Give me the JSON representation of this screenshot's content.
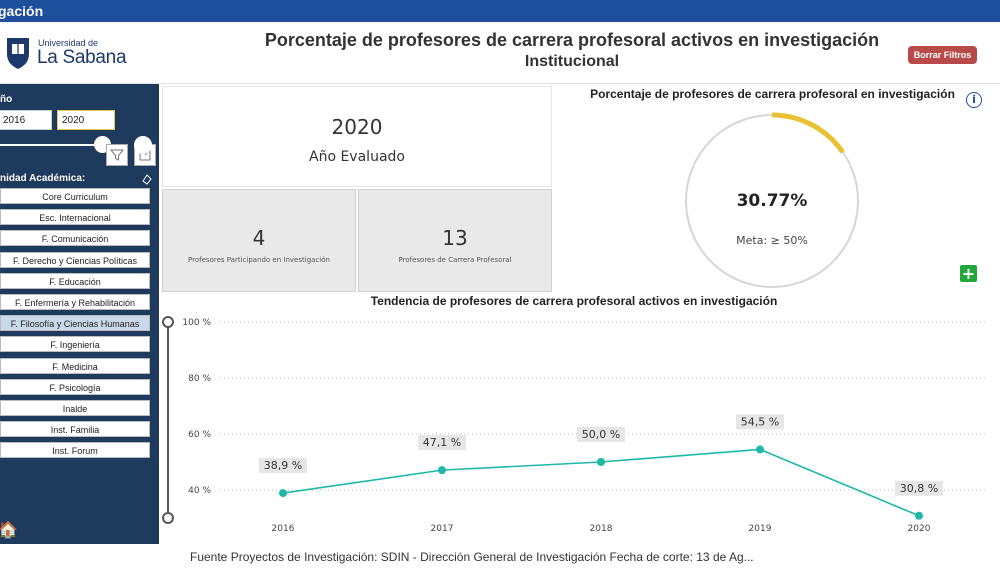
{
  "topbar": {
    "title": "gación"
  },
  "header": {
    "logo_line1": "Universidad de",
    "logo_line2": "La Sabana",
    "title_line1": "Porcentaje de profesores de carrera profesoral activos en investigación",
    "title_line2": "Institucional",
    "clear_filters": "Borrar Filtros"
  },
  "sidebar": {
    "year_label": "ño",
    "year_from": "2016",
    "year_to": "2020",
    "unit_label": "nidad Académica:",
    "units": [
      "Core Curriculum",
      "Esc. Internacional",
      "F. Comunicación",
      "F. Derecho y Ciencias Políticas",
      "F. Educación",
      "F. Enfermería y Rehabilitación",
      "F. Filosofía y Ciencias Humanas",
      "F. Ingeniería",
      "F. Medicina",
      "F. Psicología",
      "Inalde",
      "Inst. Familia",
      "Inst. Forum"
    ],
    "selected_unit_index": 6
  },
  "kpis": {
    "year_value": "2020",
    "year_label": "Año Evaluado",
    "participating_value": "4",
    "participating_label": "Profesores Participando en Investigación",
    "career_value": "13",
    "career_label": "Profesores de Carrera Profesoral"
  },
  "gauge": {
    "title": "Porcentaje de profesores de carrera profesoral en investigación",
    "value_text": "30.77%",
    "value": 30.77,
    "target_text": "Meta: ≥ 50%",
    "color": "#e8c234"
  },
  "chart_data": {
    "type": "line",
    "title": "Tendencia de profesores de carrera profesoral activos en investigación",
    "x": [
      "2016",
      "2017",
      "2018",
      "2019",
      "2020"
    ],
    "values": [
      38.9,
      47.1,
      50.0,
      54.5,
      30.8
    ],
    "labels": [
      "38,9 %",
      "47,1 %",
      "50,0 %",
      "54,5 %",
      "30,8 %"
    ],
    "yticks": [
      "40 %",
      "60 %",
      "80 %",
      "100 %"
    ],
    "ytick_values": [
      40,
      60,
      80,
      100
    ],
    "ylim": [
      30,
      100
    ],
    "color": "#1fb8a8",
    "grid": true
  },
  "footer": "Fuente Proyectos de Investigación: SDIN - Dirección General de Investigación Fecha de corte: 13 de Ag..."
}
